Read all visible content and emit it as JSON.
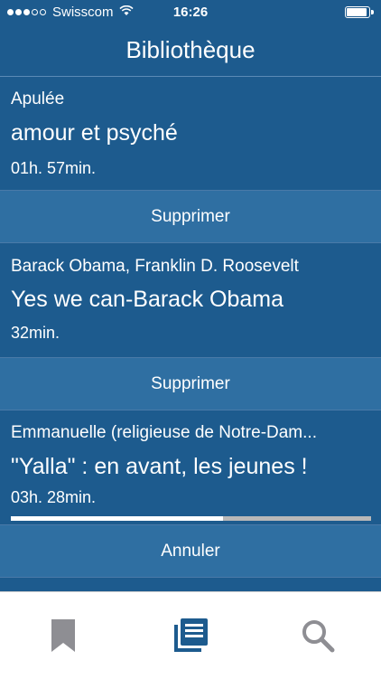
{
  "status_bar": {
    "carrier": "Swisscom",
    "time": "16:26"
  },
  "nav": {
    "title": "Bibliothèque"
  },
  "books": [
    {
      "author": "Apulée",
      "title": "amour et psyché",
      "duration": "01h. 57min.",
      "action_label": "Supprimer"
    },
    {
      "author": "Barack Obama, Franklin D. Roosevelt",
      "title": "Yes we can-Barack Obama",
      "duration": "32min.",
      "action_label": "Supprimer"
    },
    {
      "author": "Emmanuelle (religieuse de Notre-Dam...",
      "title": "\"Yalla\"  : en avant, les jeunes !",
      "duration": "03h. 28min.",
      "action_label": "Annuler",
      "download_progress": 0.59
    }
  ],
  "tab_bar": {
    "tabs": [
      {
        "icon": "bookmark-icon",
        "active": false
      },
      {
        "icon": "library-icon",
        "active": true
      },
      {
        "icon": "search-icon",
        "active": false
      }
    ],
    "colors": {
      "active": "#1d5b8e",
      "inactive": "#8e8e93"
    }
  }
}
